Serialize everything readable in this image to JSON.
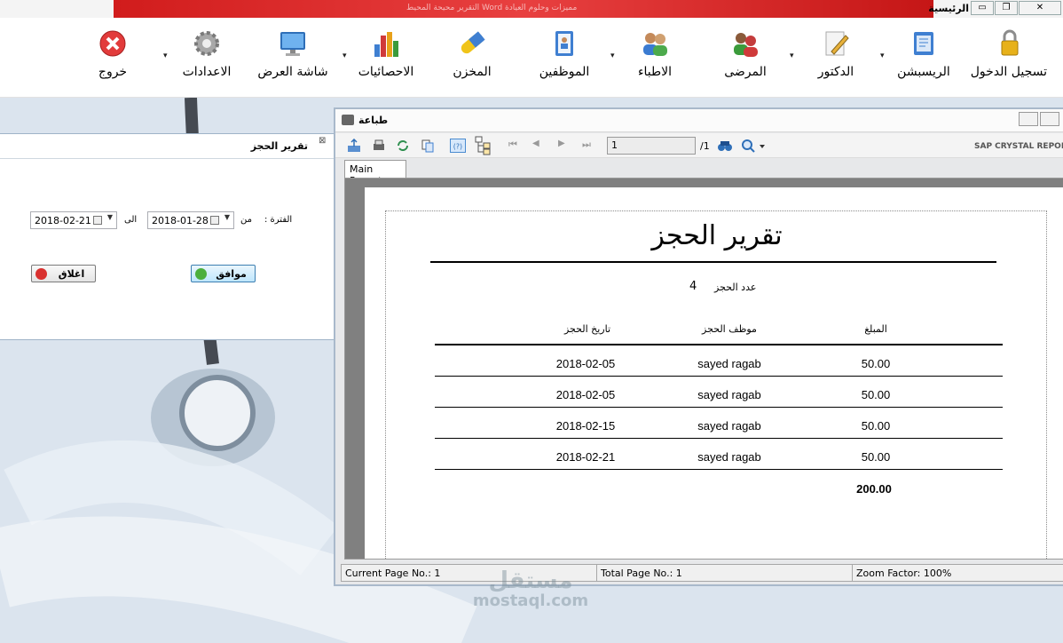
{
  "app": {
    "title": "الرئيسية",
    "banner_text": "مميزات وحلوم العيادة    Word التقرير محيحة المحيط"
  },
  "toolbar": {
    "items": [
      {
        "label": "تسجيل الدخول",
        "icon": "lock-icon"
      },
      {
        "label": "الريسبشن",
        "icon": "notepad-icon"
      },
      {
        "label": "الدكتور",
        "icon": "pencil-paper-icon"
      },
      {
        "label": "المرضى",
        "icon": "patients-icon"
      },
      {
        "label": "الاطباء",
        "icon": "doctors-icon"
      },
      {
        "label": "الموظفين",
        "icon": "address-book-icon"
      },
      {
        "label": "المخزن",
        "icon": "capsule-icon"
      },
      {
        "label": "الاحصائيات",
        "icon": "bar-chart-icon"
      },
      {
        "label": "شاشة العرض",
        "icon": "monitor-icon"
      },
      {
        "label": "الاعدادات",
        "icon": "gear-icon"
      },
      {
        "label": "خروج",
        "icon": "exit-icon"
      }
    ]
  },
  "dialog": {
    "title": "تقرير الحجز",
    "period_label": "الفترة :",
    "from_label": "من",
    "to_label": "الى",
    "from_date": "2018-01-28",
    "to_date": "2018-02-21",
    "ok_label": "موافق",
    "close_label": "اغلاق"
  },
  "print_window": {
    "title": "طباعة",
    "page_input": "1",
    "page_total": "/1",
    "brand": "SAP CRYSTAL REPOR",
    "tab_label": "Main Report",
    "colors": {
      "accent": "#4a8bd0"
    }
  },
  "report": {
    "title": "تقرير الحجز",
    "count_label": "عدد الحجز",
    "count_value": "4",
    "columns": [
      "المبلغ",
      "موظف الحجز",
      "تاريخ الحجز"
    ],
    "rows": [
      {
        "amount": "50.00",
        "employee": "sayed ragab",
        "date": "2018-02-05"
      },
      {
        "amount": "50.00",
        "employee": "sayed ragab",
        "date": "2018-02-05"
      },
      {
        "amount": "50.00",
        "employee": "sayed ragab",
        "date": "2018-02-15"
      },
      {
        "amount": "50.00",
        "employee": "sayed ragab",
        "date": "2018-02-21"
      }
    ],
    "total": "200.00"
  },
  "status_bar": {
    "current_page": "Current Page No.: 1",
    "total_page": "Total Page No.: 1",
    "zoom": "Zoom Factor: 100%"
  },
  "watermark": {
    "arabic": "مستقل",
    "latin": "mostaql.com"
  }
}
